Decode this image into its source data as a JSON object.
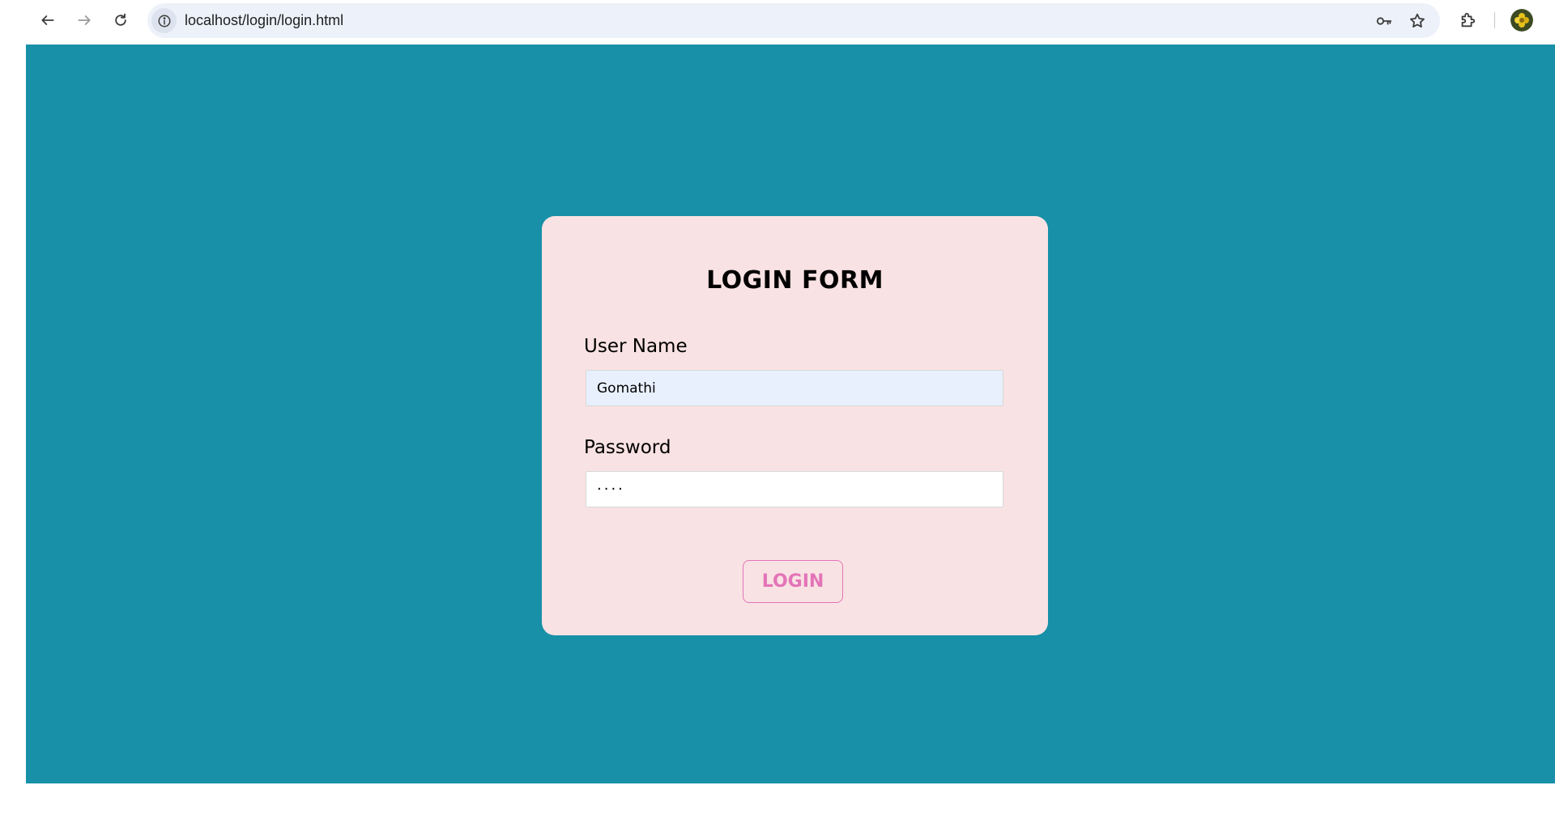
{
  "browser": {
    "url": "localhost/login/login.html",
    "icons": {
      "back": "arrow-left-icon",
      "forward": "arrow-right-icon",
      "reload": "reload-icon",
      "site_info": "info-icon",
      "password_manager": "key-icon",
      "bookmark": "star-icon",
      "extensions": "puzzle-icon",
      "profile": "avatar"
    }
  },
  "page": {
    "background_color": "#1790a8",
    "card_color": "#f9e2e3",
    "accent_color": "#e374b8"
  },
  "login_form": {
    "title": "LOGIN FORM",
    "username_label": "User Name",
    "username_value": "Gomathi",
    "password_label": "Password",
    "password_value": "····",
    "submit_label": "LOGIN"
  }
}
